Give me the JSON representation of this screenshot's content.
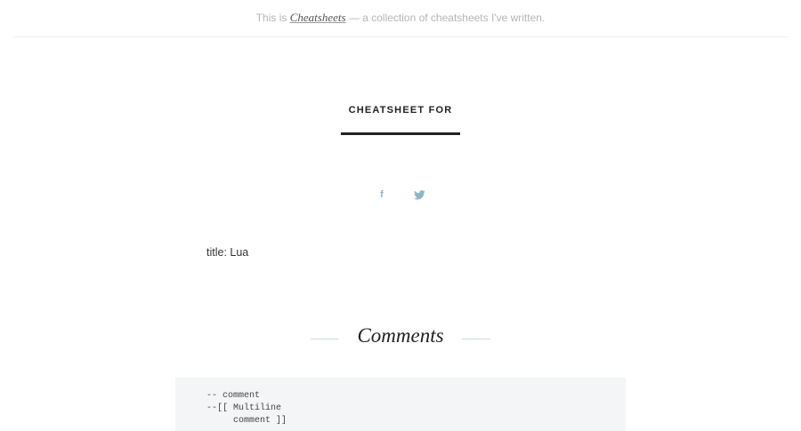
{
  "topbar": {
    "prefix": "This is ",
    "link_label": "Cheatsheets",
    "suffix": " — a collection of cheatsheets I've written."
  },
  "page": {
    "title": "CHEATSHEET FOR",
    "frontmatter": "title: Lua"
  },
  "share": {
    "facebook_glyph": "f",
    "facebook_icon": "facebook-icon",
    "twitter_icon": "twitter-icon"
  },
  "sections": [
    {
      "heading": "Comments",
      "code_lines": [
        "-- comment",
        "--[[ Multiline",
        "     comment ]]"
      ]
    }
  ],
  "colors": {
    "accent": "#8db7c9",
    "code_bg": "#f4f5f6",
    "rule": "#222222"
  }
}
